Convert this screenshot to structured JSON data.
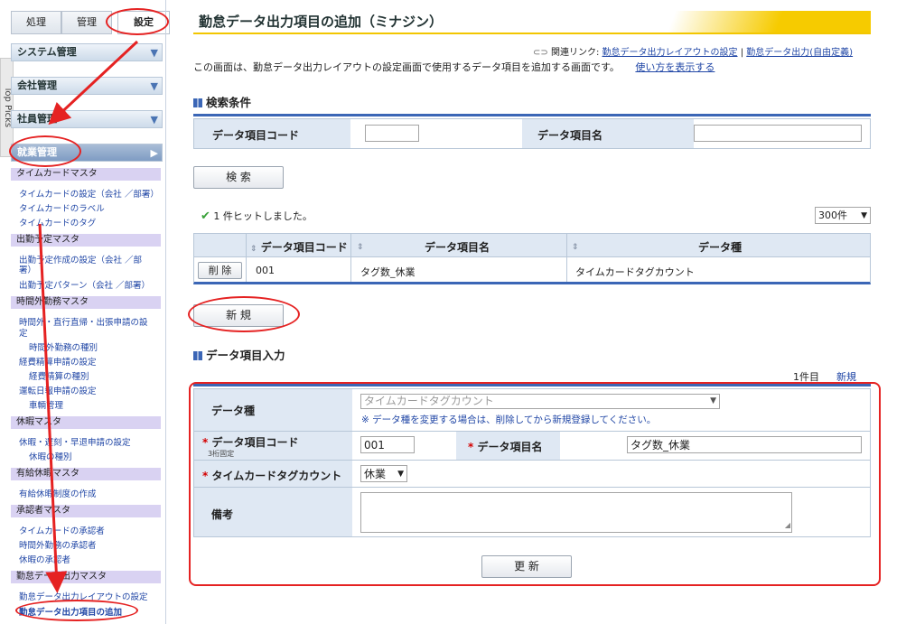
{
  "sidebar": {
    "tabs": [
      "処理",
      "管理",
      "設定"
    ],
    "vertical_tab": "Top Picks",
    "sections": [
      "システム管理",
      "会社管理",
      "社員管理",
      "就業管理"
    ],
    "groups": [
      {
        "head": "タイムカードマスタ",
        "items": [
          "タイムカードの設定（会社 ／部署）",
          "タイムカードのラベル",
          "タイムカードのタグ"
        ]
      },
      {
        "head": "出勤予定マスタ",
        "items": [
          "出勤予定作成の設定（会社 ／部",
          "署）",
          "出勤予定パターン（会社 ／部署）"
        ]
      },
      {
        "head": "時間外勤務マスタ",
        "items": [
          "時間外・直行直帰・出張申請の設",
          "定",
          "時間外勤務の種別",
          "経費精算申請の設定",
          "経費精算の種別",
          "運転日報申請の設定",
          "車輌管理"
        ]
      },
      {
        "head": "休暇マスタ",
        "items": [
          "休暇・遅刻・早退申請の設定",
          "休暇の種別"
        ]
      },
      {
        "head": "有給休暇マスタ",
        "items": [
          "有給休暇制度の作成"
        ]
      },
      {
        "head": "承認者マスタ",
        "items": [
          "タイムカードの承認者",
          "時間外勤務の承認者",
          "休暇の承認者"
        ]
      },
      {
        "head": "勤怠データ出力マスタ",
        "items": [
          "勤怠データ出力レイアウトの設定",
          "勤怠データ出力項目の追加"
        ]
      }
    ]
  },
  "page": {
    "title": "勤怠データ出力項目の追加（ミナジン）",
    "related_label": "関連リンク:",
    "related_links": [
      "勤怠データ出力レイアウトの設定",
      "勤怠データ出力(自由定義)"
    ],
    "separator": "|",
    "description": "この画面は、勤怠データ出力レイアウトの設定画面で使用するデータ項目を追加する画面です。",
    "help_link": "使い方を表示する"
  },
  "search": {
    "heading": "検索条件",
    "code_label": "データ項目コード",
    "name_label": "データ項目名",
    "code_value": "",
    "name_value": "",
    "button": "検 索"
  },
  "results": {
    "hits": "1 件ヒットしました。",
    "per_page": "300件",
    "columns": [
      "データ項目コード",
      "データ項目名",
      "データ種"
    ],
    "rows": [
      {
        "action": "削 除",
        "code": "001",
        "name": "タグ数_休業",
        "type": "タイムカードタグカウント"
      }
    ],
    "new_button": "新 規"
  },
  "entry": {
    "heading": "データ項目入力",
    "count": "1件目",
    "mode": "新規",
    "type_label": "データ種",
    "type_value": "タイムカードタグカウント",
    "type_note": "※ データ種を変更する場合は、削除してから新規登録してください。",
    "code_label": "データ項目コード",
    "code_sub": "3桁固定",
    "code_value": "001",
    "name_label": "データ項目名",
    "name_value": "タグ数_休業",
    "tag_label": "タイムカードタグカウント",
    "tag_value": "休業",
    "note_label": "備考",
    "note_value": "",
    "required": "*",
    "update_button": "更 新"
  },
  "colors": {
    "accent": "#f2c600",
    "annotation": "#e52222",
    "nav_blue": "#3b66b6"
  }
}
